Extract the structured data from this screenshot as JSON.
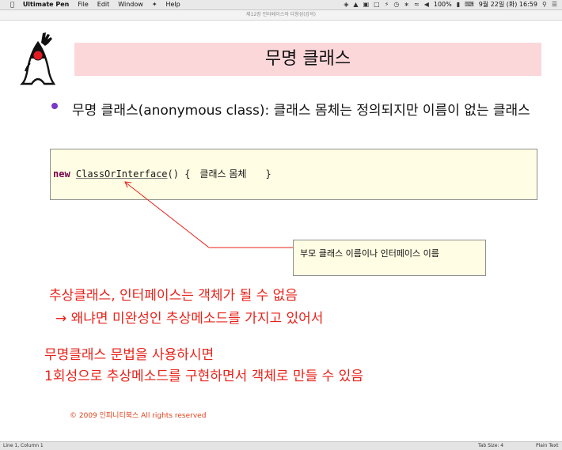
{
  "menubar": {
    "app_name": "Ultimate Pen",
    "menus": [
      "File",
      "Edit",
      "Window",
      "Help"
    ],
    "battery": "100%",
    "clock": "9월 22일 (화)  16:59"
  },
  "window": {
    "title": "제12장 인터페이스와 다형성(강의)"
  },
  "slide": {
    "title": "무명 클래스",
    "bullet": "무명 클래스(anonymous class): 클래스 몸체는 정의되지만 이름이 없는 클래스",
    "code": {
      "keyword": "new",
      "class_name": "ClassOrInterface",
      "open": "() {",
      "body": "클래스 몸체",
      "close": "}"
    },
    "callout": "부모 클래스 이름이나 인터페이스 이름",
    "red_lines": [
      "추상클래스, 인터페이스는 객체가 될 수 없음",
      "→ 왜냐면 미완성인 추상메소드를 가지고 있어서",
      "무명클래스 문법을 사용하시면",
      "1회성으로 추상메소드를 구현하면서 객체로 만들 수 있음"
    ],
    "copyright": "© 2009 인피니티북스  All rights reserved"
  },
  "status": {
    "position": "Line 1, Column 1",
    "tab_size": "Tab Size: 4",
    "mode": "Plain Text"
  },
  "colors": {
    "title_band": "#fcd7da",
    "code_box": "#fffde3",
    "red_text": "#e8221a",
    "bullet": "#7a37c9"
  }
}
